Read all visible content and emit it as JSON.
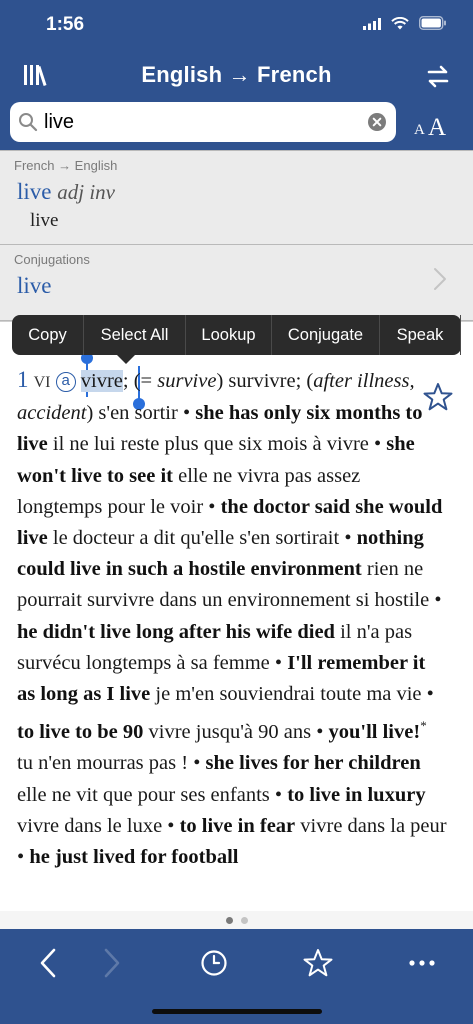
{
  "status_bar": {
    "time": "1:56"
  },
  "nav": {
    "title": "English → French"
  },
  "search": {
    "value": "live",
    "font_small": "A",
    "font_big": "A"
  },
  "results": [
    {
      "header": "French → English",
      "headword": "live",
      "pos": "adj inv",
      "translation": "live"
    },
    {
      "header": "Conjugations",
      "headword": "live"
    }
  ],
  "context_menu": {
    "items": [
      "Copy",
      "Select All",
      "Lookup",
      "Conjugate",
      "Speak"
    ]
  },
  "entry": {
    "sense_number": "1",
    "grammar": "VI",
    "circle_label": "a",
    "selected_word": "vivre",
    "lines": [
      "; (= ",
      "survive",
      ") survivre; (",
      "after illness, accident",
      ") s'en sortir •",
      "she has only six months to live",
      " il ne lui reste plus que six mois à vivre •",
      "she won't live to see it",
      " elle ne vivra pas assez longtemps pour le voir •",
      "the doctor said she would live",
      " le docteur a dit qu'elle s'en sortirait •",
      "nothing could live in such a hostile environment",
      " rien ne pourrait survivre dans un environnement si hostile •",
      "he didn't live long after his wife died",
      " il n'a pas survécu longtemps à sa femme •",
      "I'll remember it as long as I live",
      " je m'en souviendrai toute ma vie •",
      "to live to be 90",
      " vivre jusqu'à 90 ans •",
      "you'll live!",
      "*",
      " tu n'en mourras pas ! •",
      "she lives for her children",
      " elle ne vit que pour ses enfants •",
      "to live in luxury",
      " vivre dans le luxe •",
      "to live in fear",
      " vivre dans la peur •",
      "he just lived for football"
    ]
  },
  "pagination": {
    "total": 2,
    "current": 1
  },
  "colors": {
    "brand_blue": "#2f528f",
    "link_blue": "#2b5ca8",
    "selection": "#c6d7ec",
    "menu_bg": "#2b2b2b"
  },
  "icons": {
    "library": "library-icon",
    "swap": "swap-languages-icon",
    "search": "search-icon",
    "clear": "clear-icon",
    "star": "star-icon",
    "back": "back-chevron-icon",
    "forward": "forward-chevron-icon",
    "history": "clock-icon",
    "favorites": "star-outline-icon",
    "more": "more-dots-icon"
  }
}
